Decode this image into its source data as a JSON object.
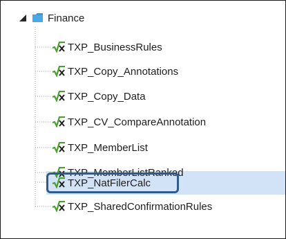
{
  "tree": {
    "root": {
      "label": "Finance",
      "expanded": true,
      "icon": "folder-icon",
      "color": "#3a9bdc"
    },
    "children": [
      {
        "label": "TXP_BusinessRules",
        "icon": "formula-icon",
        "selected": false
      },
      {
        "label": "TXP_Copy_Annotations",
        "icon": "formula-icon",
        "selected": false
      },
      {
        "label": "TXP_Copy_Data",
        "icon": "formula-icon",
        "selected": false
      },
      {
        "label": "TXP_CV_CompareAnnotation",
        "icon": "formula-icon",
        "selected": false
      },
      {
        "label": "TXP_MemberList",
        "icon": "formula-icon",
        "selected": false
      },
      {
        "label": "TXP_MemberListRanked",
        "icon": "formula-icon",
        "selected": false
      },
      {
        "label": "TXP_NatFilerCalc",
        "icon": "formula-icon",
        "selected": true
      },
      {
        "label": "TXP_SharedConfirmationRules",
        "icon": "formula-icon",
        "selected": false
      }
    ],
    "selection_color": "#d3e3f7",
    "highlight_border_color": "#2e5a8c"
  }
}
